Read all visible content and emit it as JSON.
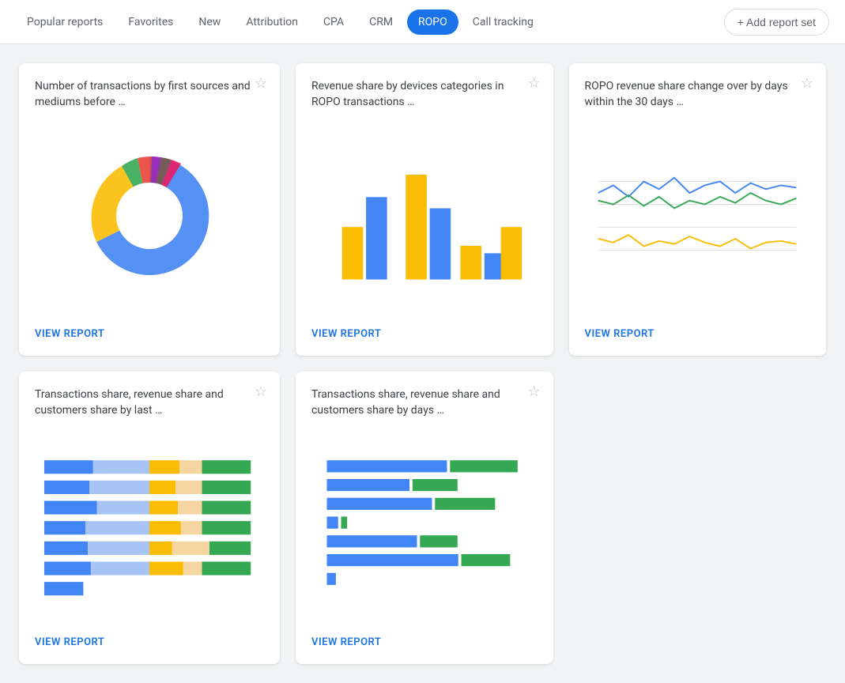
{
  "nav": {
    "items": [
      {
        "label": "Popular reports",
        "active": false
      },
      {
        "label": "Favorites",
        "active": false
      },
      {
        "label": "New",
        "active": false
      },
      {
        "label": "Attribution",
        "active": false
      },
      {
        "label": "CPA",
        "active": false
      },
      {
        "label": "CRM",
        "active": false
      },
      {
        "label": "ROPO",
        "active": true
      },
      {
        "label": "Call tracking",
        "active": false
      }
    ],
    "add_button": "+ Add report set"
  },
  "cards": [
    {
      "title": "Number of transactions by first sources and mediums before …",
      "view_report": "VIEW REPORT"
    },
    {
      "title": "Revenue share by devices categories in ROPO transactions …",
      "view_report": "VIEW REPORT"
    },
    {
      "title": "ROPO revenue share change over by days within the 30 days …",
      "view_report": "VIEW REPORT"
    },
    {
      "title": "Transactions share, revenue share and customers share by last …",
      "view_report": "VIEW REPORT"
    },
    {
      "title": "Transactions share, revenue share and customers share by days …",
      "view_report": "VIEW REPORT"
    }
  ]
}
